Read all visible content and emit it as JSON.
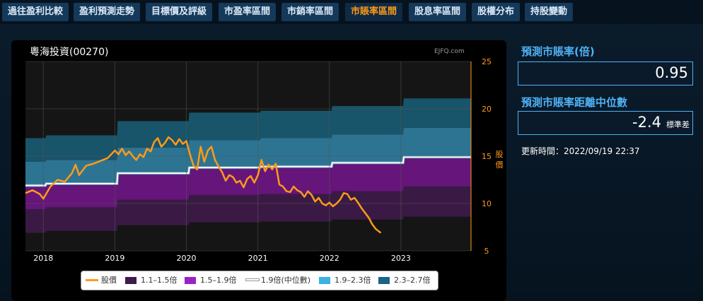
{
  "tabs": [
    {
      "label": "過往盈利比較",
      "active": false
    },
    {
      "label": "盈利預測走勢",
      "active": false
    },
    {
      "label": "目標價及評級",
      "active": false
    },
    {
      "label": "市盈率區間",
      "active": false
    },
    {
      "label": "市銷率區間",
      "active": false
    },
    {
      "label": "市賬率區間",
      "active": true
    },
    {
      "label": "股息率區間",
      "active": false
    },
    {
      "label": "股權分布",
      "active": false
    },
    {
      "label": "持股變動",
      "active": false
    }
  ],
  "chart_header": {
    "title": "粵海投資(00270)",
    "source": "EJFQ.com"
  },
  "side": {
    "pb_title": "預測市賬率(倍)",
    "pb_value": "0.95",
    "dist_title": "預測市賬率距離中位數",
    "dist_value": "-2.4",
    "dist_unit": "標準差",
    "updated": "更新時間：2022/09/19 22:37"
  },
  "chart_data": {
    "type": "area",
    "title": "粵海投資(00270)",
    "x_axis": {
      "ticks": [
        "2018",
        "2019",
        "2020",
        "2021",
        "2022",
        "2023"
      ],
      "range": [
        2017.75,
        2023.98
      ]
    },
    "y_axis": {
      "label": "股價",
      "position": "right",
      "ticks": [
        5,
        10,
        15,
        20,
        25
      ],
      "ylim": [
        5,
        25
      ]
    },
    "band_bounds": {
      "x": [
        2017.75,
        2018.03,
        2018.04,
        2019.03,
        2019.04,
        2020.03,
        2020.04,
        2021.03,
        2021.04,
        2022.03,
        2022.04,
        2023.03,
        2023.04,
        2023.98
      ],
      "levels": [
        {
          "name": "1.1x",
          "values": [
            6.9,
            6.9,
            7.1,
            7.1,
            7.7,
            7.7,
            8.0,
            8.0,
            8.1,
            8.1,
            8.3,
            8.3,
            8.6,
            8.6
          ]
        },
        {
          "name": "1.5x",
          "values": [
            9.4,
            9.4,
            9.6,
            9.6,
            10.4,
            10.4,
            10.9,
            10.9,
            11.0,
            11.0,
            11.3,
            11.3,
            11.8,
            11.8
          ]
        },
        {
          "name": "1.9x",
          "values": [
            11.9,
            11.9,
            12.1,
            12.1,
            13.2,
            13.2,
            13.8,
            13.8,
            13.9,
            13.9,
            14.3,
            14.3,
            14.9,
            14.9
          ]
        },
        {
          "name": "2.3x",
          "values": [
            14.4,
            14.4,
            14.6,
            14.6,
            15.9,
            15.9,
            16.7,
            16.7,
            16.9,
            16.9,
            17.3,
            17.3,
            18.0,
            18.0
          ]
        },
        {
          "name": "2.7x",
          "values": [
            16.9,
            16.9,
            17.2,
            17.2,
            18.7,
            18.7,
            19.6,
            19.6,
            19.8,
            19.8,
            20.3,
            20.3,
            21.1,
            21.1
          ]
        }
      ]
    },
    "price": {
      "name": "股價",
      "x": [
        2017.75,
        2017.85,
        2017.95,
        2018.0,
        2018.1,
        2018.2,
        2018.3,
        2018.4,
        2018.45,
        2018.5,
        2018.6,
        2018.7,
        2018.8,
        2018.9,
        2019.0,
        2019.05,
        2019.1,
        2019.15,
        2019.2,
        2019.25,
        2019.3,
        2019.35,
        2019.4,
        2019.45,
        2019.5,
        2019.55,
        2019.6,
        2019.65,
        2019.7,
        2019.75,
        2019.8,
        2019.85,
        2019.9,
        2019.95,
        2020.0,
        2020.05,
        2020.1,
        2020.15,
        2020.2,
        2020.25,
        2020.3,
        2020.35,
        2020.4,
        2020.45,
        2020.5,
        2020.55,
        2020.6,
        2020.65,
        2020.7,
        2020.75,
        2020.8,
        2020.85,
        2020.9,
        2020.95,
        2021.0,
        2021.05,
        2021.1,
        2021.15,
        2021.2,
        2021.25,
        2021.3,
        2021.35,
        2021.4,
        2021.45,
        2021.5,
        2021.55,
        2021.6,
        2021.65,
        2021.7,
        2021.75,
        2021.8,
        2021.85,
        2021.9,
        2021.95,
        2022.0,
        2022.05,
        2022.1,
        2022.15,
        2022.2,
        2022.25,
        2022.3,
        2022.35,
        2022.4,
        2022.45,
        2022.5,
        2022.55,
        2022.6,
        2022.65,
        2022.7,
        2022.72
      ],
      "values": [
        11.1,
        11.4,
        11.0,
        10.5,
        11.8,
        12.5,
        12.3,
        13.2,
        14.1,
        13.0,
        14.0,
        14.2,
        14.5,
        14.8,
        15.6,
        15.2,
        15.8,
        15.1,
        15.5,
        15.0,
        14.6,
        15.2,
        14.9,
        15.8,
        15.5,
        16.5,
        16.9,
        16.0,
        16.4,
        17.0,
        16.7,
        16.2,
        16.8,
        16.3,
        16.6,
        15.2,
        14.0,
        13.6,
        16.0,
        14.4,
        15.6,
        16.0,
        14.6,
        13.9,
        13.3,
        12.4,
        13.0,
        12.8,
        12.2,
        12.4,
        11.7,
        12.6,
        12.9,
        12.2,
        13.0,
        14.6,
        13.4,
        14.1,
        13.6,
        14.2,
        12.0,
        11.8,
        11.3,
        11.2,
        11.8,
        11.4,
        11.2,
        10.7,
        11.3,
        10.9,
        10.2,
        10.6,
        10.0,
        9.8,
        10.1,
        9.7,
        10.0,
        10.4,
        11.1,
        11.0,
        10.4,
        10.6,
        10.1,
        9.5,
        9.0,
        8.5,
        7.8,
        7.3,
        7.0,
        6.9
      ]
    },
    "legend": [
      {
        "label": "股價",
        "color": "#ff9a1a",
        "kind": "line"
      },
      {
        "label": "1.1–1.5倍",
        "color": "#3e1a4d",
        "kind": "box"
      },
      {
        "label": "1.5–1.9倍",
        "color": "#9a21c6",
        "kind": "box"
      },
      {
        "label": "1.9倍(中位數)",
        "color": "#ffffff",
        "kind": "line"
      },
      {
        "label": "1.9–2.3倍",
        "color": "#3cb2e6",
        "kind": "box"
      },
      {
        "label": "2.3–2.7倍",
        "color": "#1a6585",
        "kind": "box"
      }
    ],
    "band_fill_colors": [
      "#3a1a45",
      "#66157a",
      "#2c7492",
      "#18546a"
    ],
    "grid": true,
    "legend_position": "bottom-center"
  }
}
